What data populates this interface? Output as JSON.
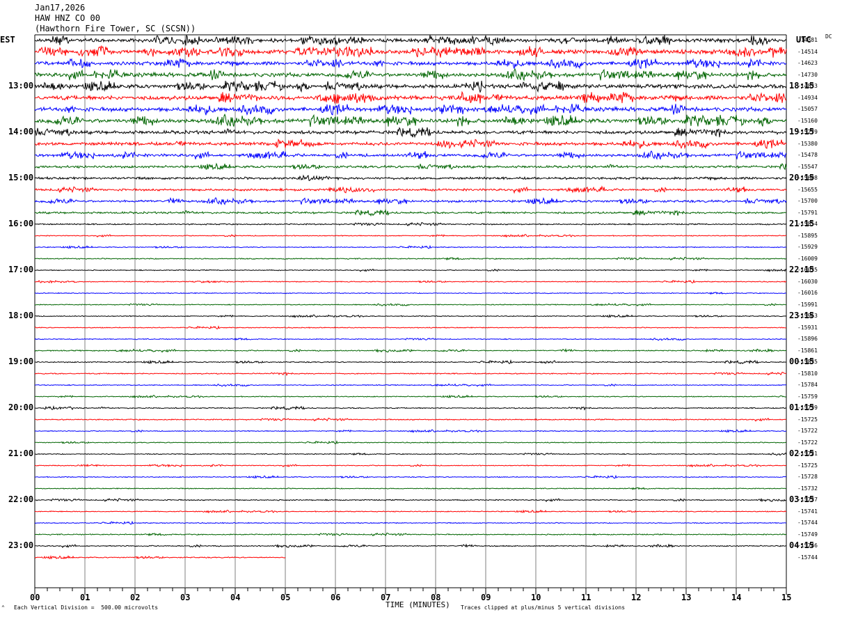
{
  "header": {
    "date": "Jan17,2026",
    "station": "HAW HNZ CO 00",
    "location": "(Hawthorn Fire Tower, SC (SCSN))"
  },
  "labels": {
    "left_zone": "EST",
    "right_zone": "UTC",
    "dc": "DC",
    "xaxis_title": "TIME (MINUTES)",
    "scale_note": "Each Vertical Division =  500.00 microvolts",
    "clip_note": "Traces clipped at plus/minus 5 vertical divisions"
  },
  "colors": [
    "#000000",
    "#ff0000",
    "#0000ff",
    "#006400"
  ],
  "chart_data": {
    "type": "line",
    "title": "",
    "xlabel": "TIME (MINUTES)",
    "xlim": [
      0,
      15
    ],
    "x_ticks": [
      "00",
      "01",
      "02",
      "03",
      "04",
      "05",
      "06",
      "07",
      "08",
      "09",
      "10",
      "11",
      "12",
      "13",
      "14",
      "15"
    ],
    "rows_per_hour": 4,
    "est_hour_labels": [
      {
        "row": 4,
        "label": "13:00"
      },
      {
        "row": 8,
        "label": "14:00"
      },
      {
        "row": 12,
        "label": "15:00"
      },
      {
        "row": 16,
        "label": "16:00"
      },
      {
        "row": 20,
        "label": "17:00"
      },
      {
        "row": 24,
        "label": "18:00"
      },
      {
        "row": 28,
        "label": "19:00"
      },
      {
        "row": 32,
        "label": "20:00"
      },
      {
        "row": 36,
        "label": "21:00"
      },
      {
        "row": 40,
        "label": "22:00"
      },
      {
        "row": 44,
        "label": "23:00"
      }
    ],
    "utc_hour_labels": [
      {
        "row": 4,
        "label": "18:15"
      },
      {
        "row": 8,
        "label": "19:15"
      },
      {
        "row": 12,
        "label": "20:15"
      },
      {
        "row": 16,
        "label": "21:15"
      },
      {
        "row": 20,
        "label": "22:15"
      },
      {
        "row": 24,
        "label": "23:15"
      },
      {
        "row": 28,
        "label": "00:15"
      },
      {
        "row": 32,
        "label": "01:15"
      },
      {
        "row": 36,
        "label": "02:15"
      },
      {
        "row": 40,
        "label": "03:15"
      },
      {
        "row": 44,
        "label": "04:15"
      }
    ],
    "dc_offsets": [
      "-14381",
      "-14514",
      "-14623",
      "-14730",
      "-14833",
      "-14934",
      "-15057",
      "-15160",
      "-15279",
      "-15380",
      "-15478",
      "-15547",
      "-15608",
      "-15655",
      "-15700",
      "-15791",
      "-15854",
      "-15895",
      "-15929",
      "-16009",
      "-16035",
      "-16030",
      "-16016",
      "-15991",
      "-15963",
      "-15931",
      "-15896",
      "-15861",
      "-15835",
      "-15810",
      "-15784",
      "-15759",
      "-15739",
      "-15725",
      "-15722",
      "-15722",
      "-15721",
      "-15725",
      "-15728",
      "-15732",
      "-15737",
      "-15741",
      "-15744",
      "-15749",
      "-15746",
      "-15744"
    ],
    "activity_levels": [
      2.0,
      2.2,
      2.0,
      2.2,
      2.2,
      2.4,
      2.2,
      2.4,
      1.9,
      1.8,
      1.6,
      1.3,
      1.3,
      1.2,
      1.3,
      1.1,
      0.7,
      0.5,
      0.5,
      0.6,
      0.5,
      0.5,
      0.5,
      0.5,
      0.5,
      0.5,
      0.5,
      0.6,
      0.6,
      0.6,
      0.5,
      0.5,
      0.6,
      0.6,
      0.5,
      0.5,
      0.5,
      0.5,
      0.5,
      0.5,
      0.6,
      0.5,
      0.5,
      0.6,
      0.6,
      0.6
    ],
    "last_row_end_minute": 5.0
  }
}
